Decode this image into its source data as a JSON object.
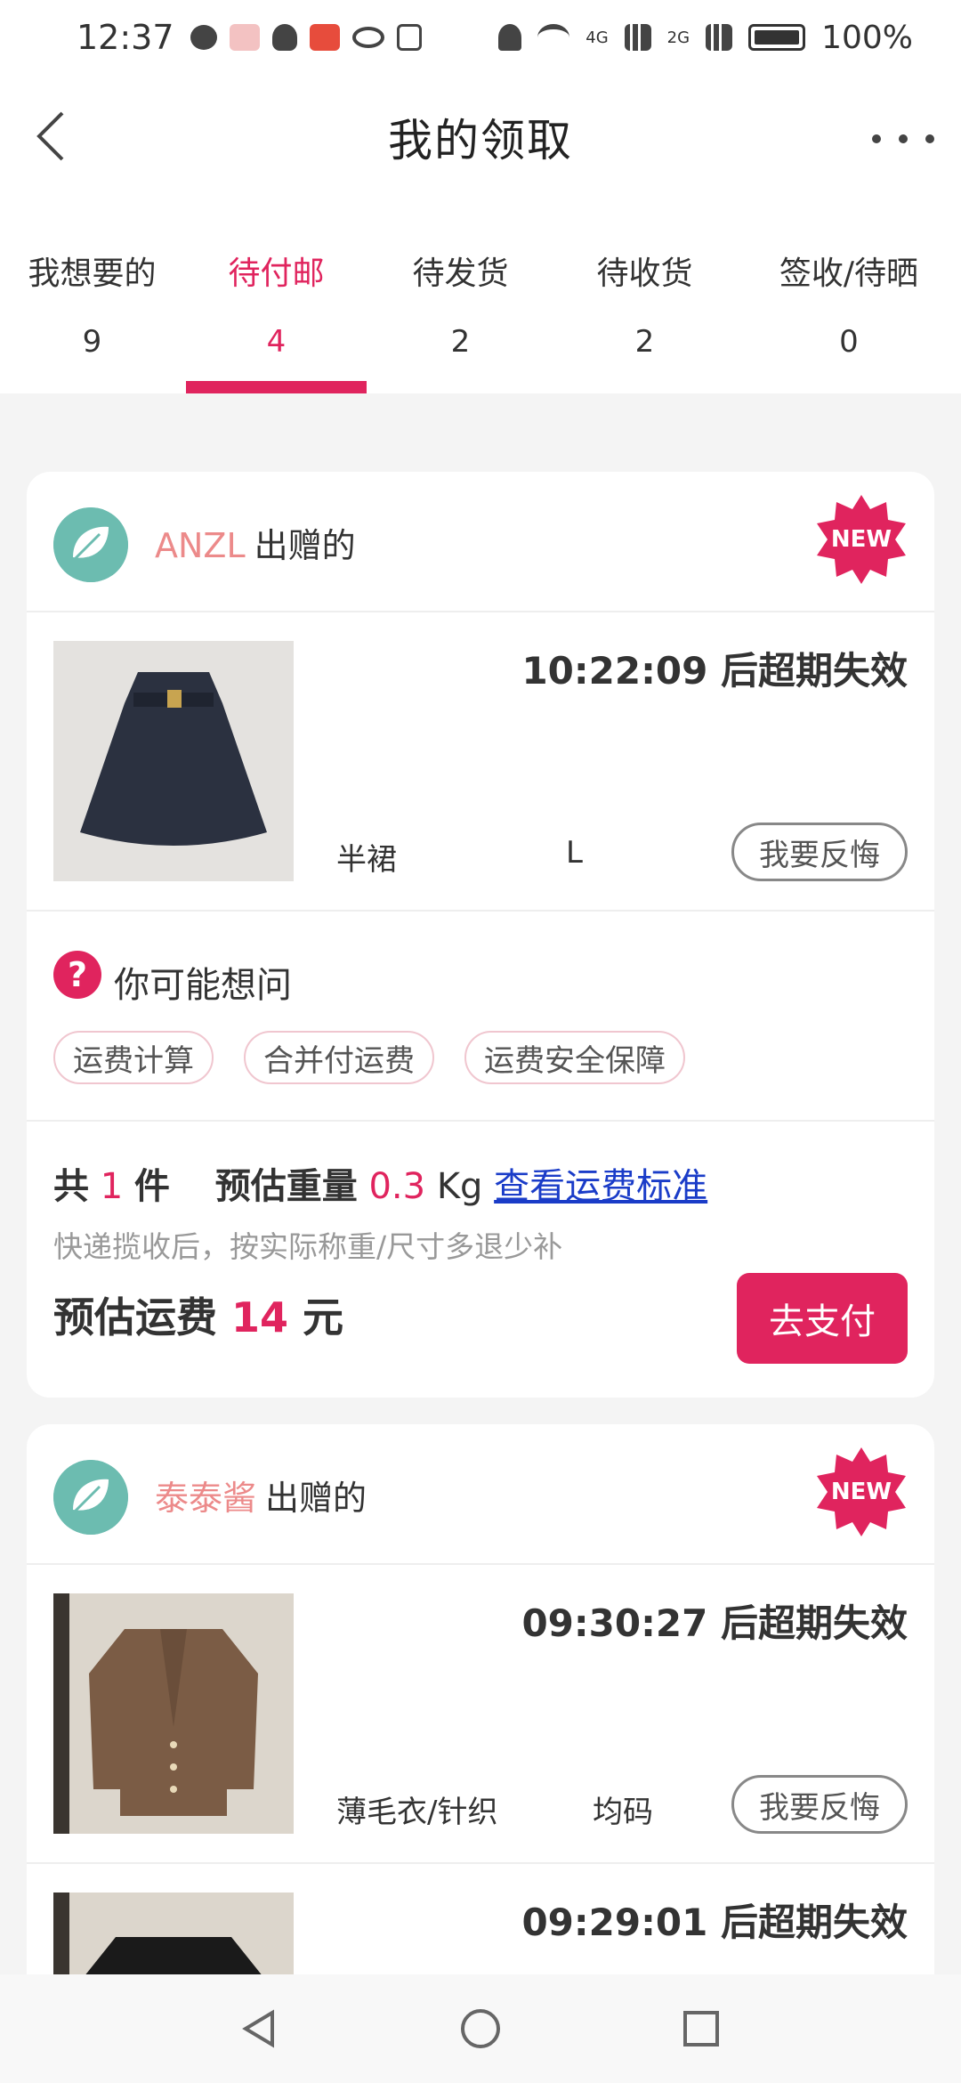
{
  "status_bar": {
    "time": "12:37",
    "battery": "100%",
    "network_1": "4G",
    "network_2": "2G"
  },
  "nav": {
    "title": "我的领取"
  },
  "tabs": [
    {
      "label": "我想要的",
      "count": "9"
    },
    {
      "label": "待付邮",
      "count": "4"
    },
    {
      "label": "待发货",
      "count": "2"
    },
    {
      "label": "待收货",
      "count": "2"
    },
    {
      "label": "签收/待晒",
      "count": "0"
    }
  ],
  "active_tab": "待付邮",
  "colors": {
    "accent": "#e0245e",
    "donor_name": "#ec8a8a",
    "link": "#1a3cc8"
  },
  "cards": [
    {
      "donor_name": "ANZL",
      "donor_suffix": "出赠的",
      "badge": "NEW",
      "items": [
        {
          "expire_text": "10:22:09 后超期失效",
          "category": "半裙",
          "size": "L",
          "regret_label": "我要反悔"
        }
      ],
      "faq": {
        "title": "你可能想问",
        "chips": [
          "运费计算",
          "合并付运费",
          "运费安全保障"
        ]
      },
      "summary": {
        "count_prefix": "共",
        "count": "1",
        "count_suffix": "件",
        "weight_label": "预估重量",
        "weight": "0.3",
        "weight_unit": "Kg",
        "link": "查看运费标准",
        "note": "快递揽收后，按实际称重/尺寸多退少补",
        "fee_label": "预估运费",
        "fee": "14",
        "fee_unit": "元",
        "pay_label": "去支付"
      }
    },
    {
      "donor_name": "泰泰酱",
      "donor_suffix": "出赠的",
      "badge": "NEW",
      "items": [
        {
          "expire_text": "09:30:27 后超期失效",
          "category": "薄毛衣/针织",
          "size": "均码",
          "regret_label": "我要反悔"
        },
        {
          "expire_text": "09:29:01 后超期失效"
        }
      ]
    }
  ]
}
